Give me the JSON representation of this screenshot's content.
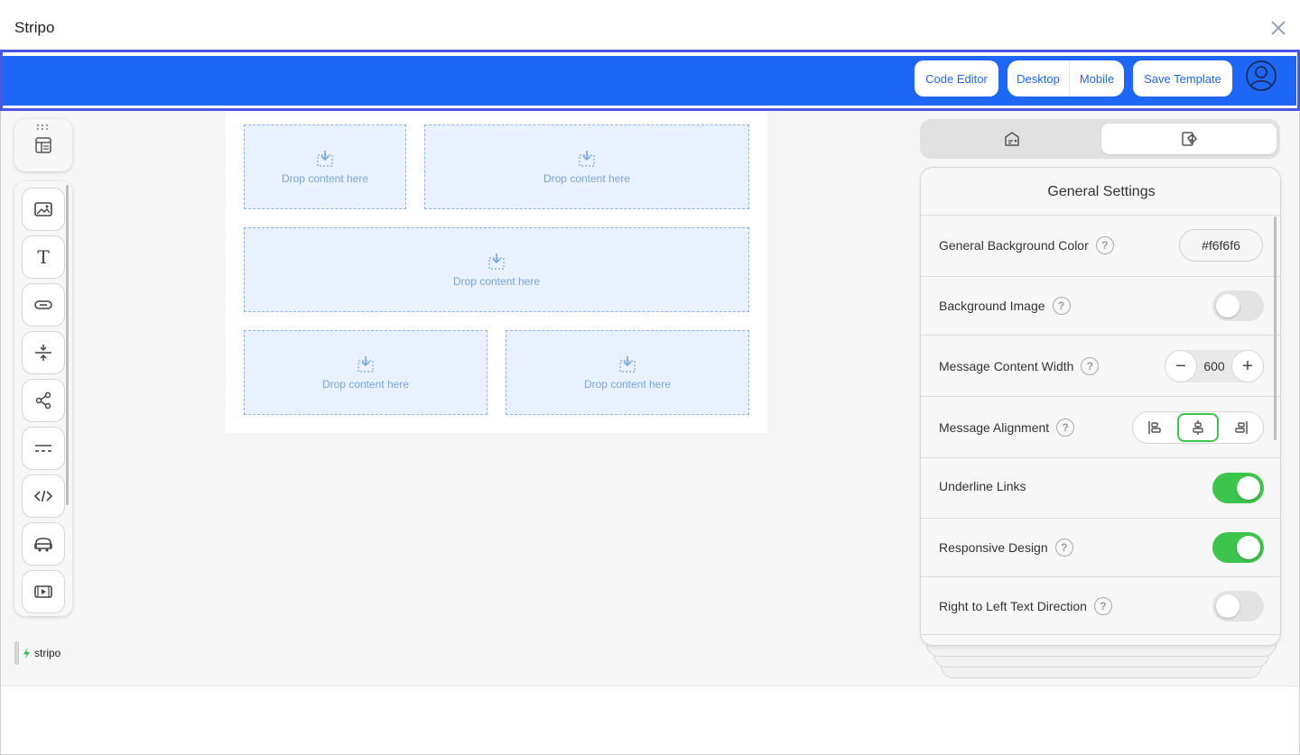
{
  "window": {
    "title": "Stripo"
  },
  "toolbar": {
    "code_editor_label": "Code Editor",
    "desktop_label": "Desktop",
    "mobile_label": "Mobile",
    "save_template_label": "Save Template"
  },
  "blocks_panel": {
    "items": [
      {
        "icon": "image-icon"
      },
      {
        "icon": "text-icon",
        "glyph": "T"
      },
      {
        "icon": "button-icon"
      },
      {
        "icon": "spacer-icon"
      },
      {
        "icon": "social-share-icon"
      },
      {
        "icon": "banner-icon"
      },
      {
        "icon": "html-code-icon"
      },
      {
        "icon": "timer-icon"
      },
      {
        "icon": "video-icon"
      }
    ]
  },
  "logo": {
    "text": "stripo"
  },
  "canvas": {
    "drop_label": "Drop content here",
    "cells": [
      {
        "label": "Drop content here"
      },
      {
        "label": "Drop content here"
      },
      {
        "label": "Drop content here"
      },
      {
        "label": "Drop content here"
      },
      {
        "label": "Drop content here"
      }
    ]
  },
  "settings": {
    "title": "General Settings",
    "help_glyph": "?",
    "background_color": {
      "label": "General Background Color",
      "value": "#f6f6f6",
      "display": "#f6f6f6"
    },
    "background_image": {
      "label": "Background Image",
      "enabled": false
    },
    "content_width": {
      "label": "Message Content Width",
      "value": "600",
      "minus": "−",
      "plus": "+"
    },
    "alignment": {
      "label": "Message Alignment",
      "options": [
        "left",
        "center",
        "right"
      ],
      "selected": "center"
    },
    "underline_links": {
      "label": "Underline Links",
      "enabled": true
    },
    "responsive_design": {
      "label": "Responsive Design",
      "enabled": true
    },
    "rtl": {
      "label": "Right to Left Text Direction",
      "enabled": false
    }
  },
  "colors": {
    "brand_blue": "#1e66f5",
    "toggle_on": "#3cc54c",
    "toggle_off": "#e3e3e3",
    "drop_zone_bg": "#e8f1fd"
  }
}
